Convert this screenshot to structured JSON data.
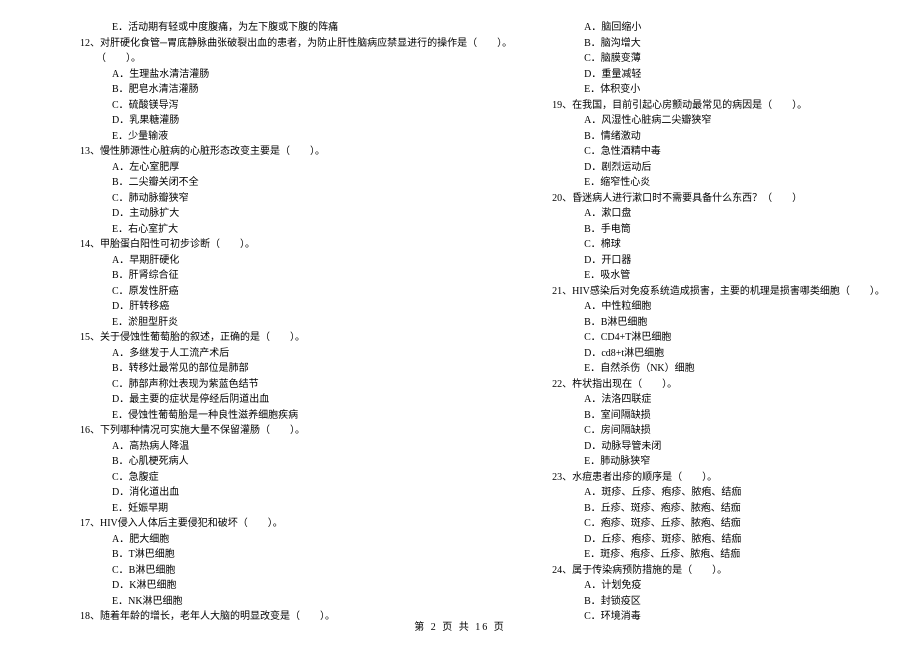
{
  "left": {
    "pre_opt": "E．活动期有轻或中度腹痛，为左下腹或下腹的阵痛",
    "q12": "12、对肝硬化食管─胃底静脉曲张破裂出血的患者，为防止肝性脑病应禁显进行的操作是（　　）。",
    "q12o": [
      "A．生理盐水清洁灌肠",
      "B．肥皂水清洁灌肠",
      "C．硫酸镁导泻",
      "D．乳果糖灌肠",
      "E．少量输液"
    ],
    "q13": "13、慢性肺源性心脏病的心脏形态改变主要是（　　）。",
    "q13o": [
      "A．左心室肥厚",
      "B．二尖瓣关闭不全",
      "C．肺动脉瓣狭窄",
      "D．主动脉扩大",
      "E．右心室扩大"
    ],
    "q14": "14、甲胎蛋白阳性可初步诊断（　　）。",
    "q14o": [
      "A．早期肝硬化",
      "B．肝肾综合征",
      "C．原发性肝癌",
      "D．肝转移癌",
      "E．淤胆型肝炎"
    ],
    "q15": "15、关于侵蚀性葡萄胎的叙述，正确的是（　　）。",
    "q15o": [
      "A．多继发于人工流产术后",
      "B．转移灶最常见的部位是肺部",
      "C．肺部声称灶表现为紫蓝色结节",
      "D．最主要的症状是停经后阴道出血",
      "E．侵蚀性葡萄胎是一种良性滋养细胞疾病"
    ],
    "q16": "16、下列哪种情况可实施大量不保留灌肠（　　）。",
    "q16o": [
      "A．高热病人降温",
      "B．心肌梗死病人",
      "C．急腹症",
      "D．消化道出血",
      "E．妊娠早期"
    ],
    "q17": "17、HIV侵入人体后主要侵犯和破坏（　　）。",
    "q17o": [
      "A．肥大细胞",
      "B．T淋巴细胞",
      "C．B淋巴细胞",
      "D．K淋巴细胞",
      "E．NK淋巴细胞"
    ],
    "q18": "18、随着年龄的增长，老年人大脑的明显改变是（　　）。"
  },
  "right": {
    "q18o": [
      "A．脑回缩小",
      "B．脑沟增大",
      "C．脑膜变薄",
      "D．重量减轻",
      "E．体积变小"
    ],
    "q19": "19、在我国，目前引起心房颤动最常见的病因是（　　）。",
    "q19o": [
      "A．风湿性心脏病二尖瓣狭窄",
      "B．情绪激动",
      "C．急性酒精中毒",
      "D．剧烈运动后",
      "E．缩窄性心炎"
    ],
    "q20": "20、昏迷病人进行漱口时不需要具备什么东西？（　　）",
    "q20o": [
      "A．漱口盘",
      "B．手电筒",
      "C．棉球",
      "D．开口器",
      "E．吸水管"
    ],
    "q21": "21、HIV感染后对免疫系统造成损害，主要的机理是损害哪类细胞（　　）。",
    "q21o": [
      "A．中性粒细胞",
      "B．B淋巴细胞",
      "C．CD4+T淋巴细胞",
      "D．cd8+t淋巴细胞",
      "E．自然杀伤（NK）细胞"
    ],
    "q22": "22、杵状指出现在（　　）。",
    "q22o": [
      "A．法洛四联症",
      "B．室间隔缺损",
      "C．房间隔缺损",
      "D．动脉导管未闭",
      "E．肺动脉狭窄"
    ],
    "q23": "23、水痘患者出疹的顺序是（　　）。",
    "q23o": [
      "A．斑疹、丘疹、疱疹、脓疱、结痂",
      "B．丘疹、斑疹、疱疹、脓疱、结痂",
      "C．疱疹、斑疹、丘疹、脓疱、结痂",
      "D．丘疹、疱疹、斑疹、脓疱、结痂",
      "E．斑疹、疱疹、丘疹、脓疱、结痂"
    ],
    "q24": "24、属于传染病预防措施的是（　　）。",
    "q24o": [
      "A．计划免疫",
      "B．封锁疫区",
      "C．环境消毒"
    ]
  },
  "footer": "第 2 页 共 16 页"
}
